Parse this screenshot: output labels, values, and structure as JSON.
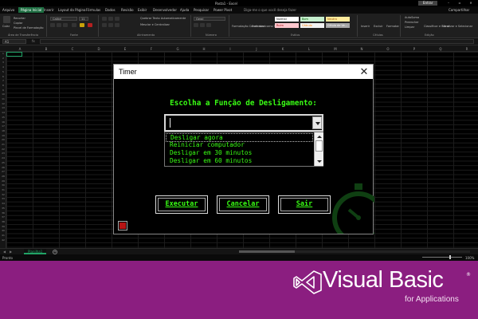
{
  "excel": {
    "window_title": "Pasta1 - Excel",
    "signin_label": "Entrar",
    "share_label": "Compartilhar",
    "tell_me": "Diga-me o que você deseja fazer",
    "tabs": [
      "Arquivo",
      "Página Inicial",
      "Inserir",
      "Layout da Página",
      "Fórmulas",
      "Dados",
      "Revisão",
      "Exibir",
      "Desenvolvedor",
      "Ajuda",
      "Pesquisar",
      "Power Pivot"
    ],
    "active_tab": "Página Inicial",
    "ribbon": {
      "paste_label": "Colar",
      "cut_label": "Recortar",
      "copy_label": "Copiar",
      "format_painter_label": "Pincel de Formatação",
      "font_name": "Calibri",
      "font_size": "11",
      "wrap_text": "Quebrar Texto Automaticamente",
      "merge_center": "Mesclar e Centralizar",
      "number_format": "Geral",
      "cond_format": "Formatação Condicional",
      "format_table": "Formatar como Tabela",
      "insert_label": "Inserir",
      "delete_label": "Excluir",
      "format_label": "Formatar",
      "autosum_label": "AutoSoma",
      "fill_label": "Preencher",
      "clear_label": "Limpar",
      "sort_filter": "Classificar e Filtrar",
      "find_select": "Localizar e Selecionar",
      "styles": [
        {
          "label": "Normal",
          "bg": "#ffffff"
        },
        {
          "label": "Bom",
          "bg": "#c6efce"
        },
        {
          "label": "Neutro",
          "bg": "#ffeb9c"
        },
        {
          "label": "Ruim",
          "bg": "#ffc7ce"
        },
        {
          "label": "Cálculo",
          "bg": "#f2f2f2"
        },
        {
          "label": "Célula de Ve...",
          "bg": "#a5a5a5"
        }
      ],
      "groups": [
        "Área de Transferência",
        "Fonte",
        "Alinhamento",
        "Número",
        "Estilos",
        "Células",
        "Edição"
      ]
    },
    "name_box": "A1",
    "fx_label": "fx",
    "columns": [
      "A",
      "B",
      "C",
      "D",
      "E",
      "F",
      "G",
      "H",
      "I",
      "J",
      "K",
      "L",
      "M",
      "N",
      "O",
      "P",
      "Q",
      "R"
    ],
    "rows": [
      "1",
      "2",
      "3",
      "4",
      "5",
      "6",
      "7",
      "8",
      "9",
      "10",
      "11",
      "12",
      "13",
      "14",
      "15",
      "16",
      "17",
      "18",
      "19",
      "20",
      "21",
      "22",
      "23",
      "24",
      "25",
      "26",
      "27",
      "28",
      "29",
      "30",
      "31",
      "32",
      "33",
      "34",
      "35",
      "36",
      "37",
      "38",
      "39",
      "40",
      "41",
      "42"
    ],
    "sheet_tab": "Planilha1",
    "add_sheet": "+",
    "status": "Pronto",
    "zoom": "100%"
  },
  "dialog": {
    "title": "Timer",
    "close_glyph": "✕",
    "heading": "Escolha a Função de Desligamento:",
    "combo_value": "",
    "options": [
      "Desligar agora",
      "Reiniciar computador",
      "Desligar em 30 minutos",
      "Desligar em 60 minutos"
    ],
    "selected_index": 0,
    "buttons": {
      "execute": "Executar",
      "cancel": "Cancelar",
      "exit": "Sair"
    },
    "accent_color": "#39ff14"
  },
  "banner": {
    "title": "Visual Basic",
    "registered": "®",
    "subtitle": "for Applications",
    "background": "#8b1e80"
  }
}
